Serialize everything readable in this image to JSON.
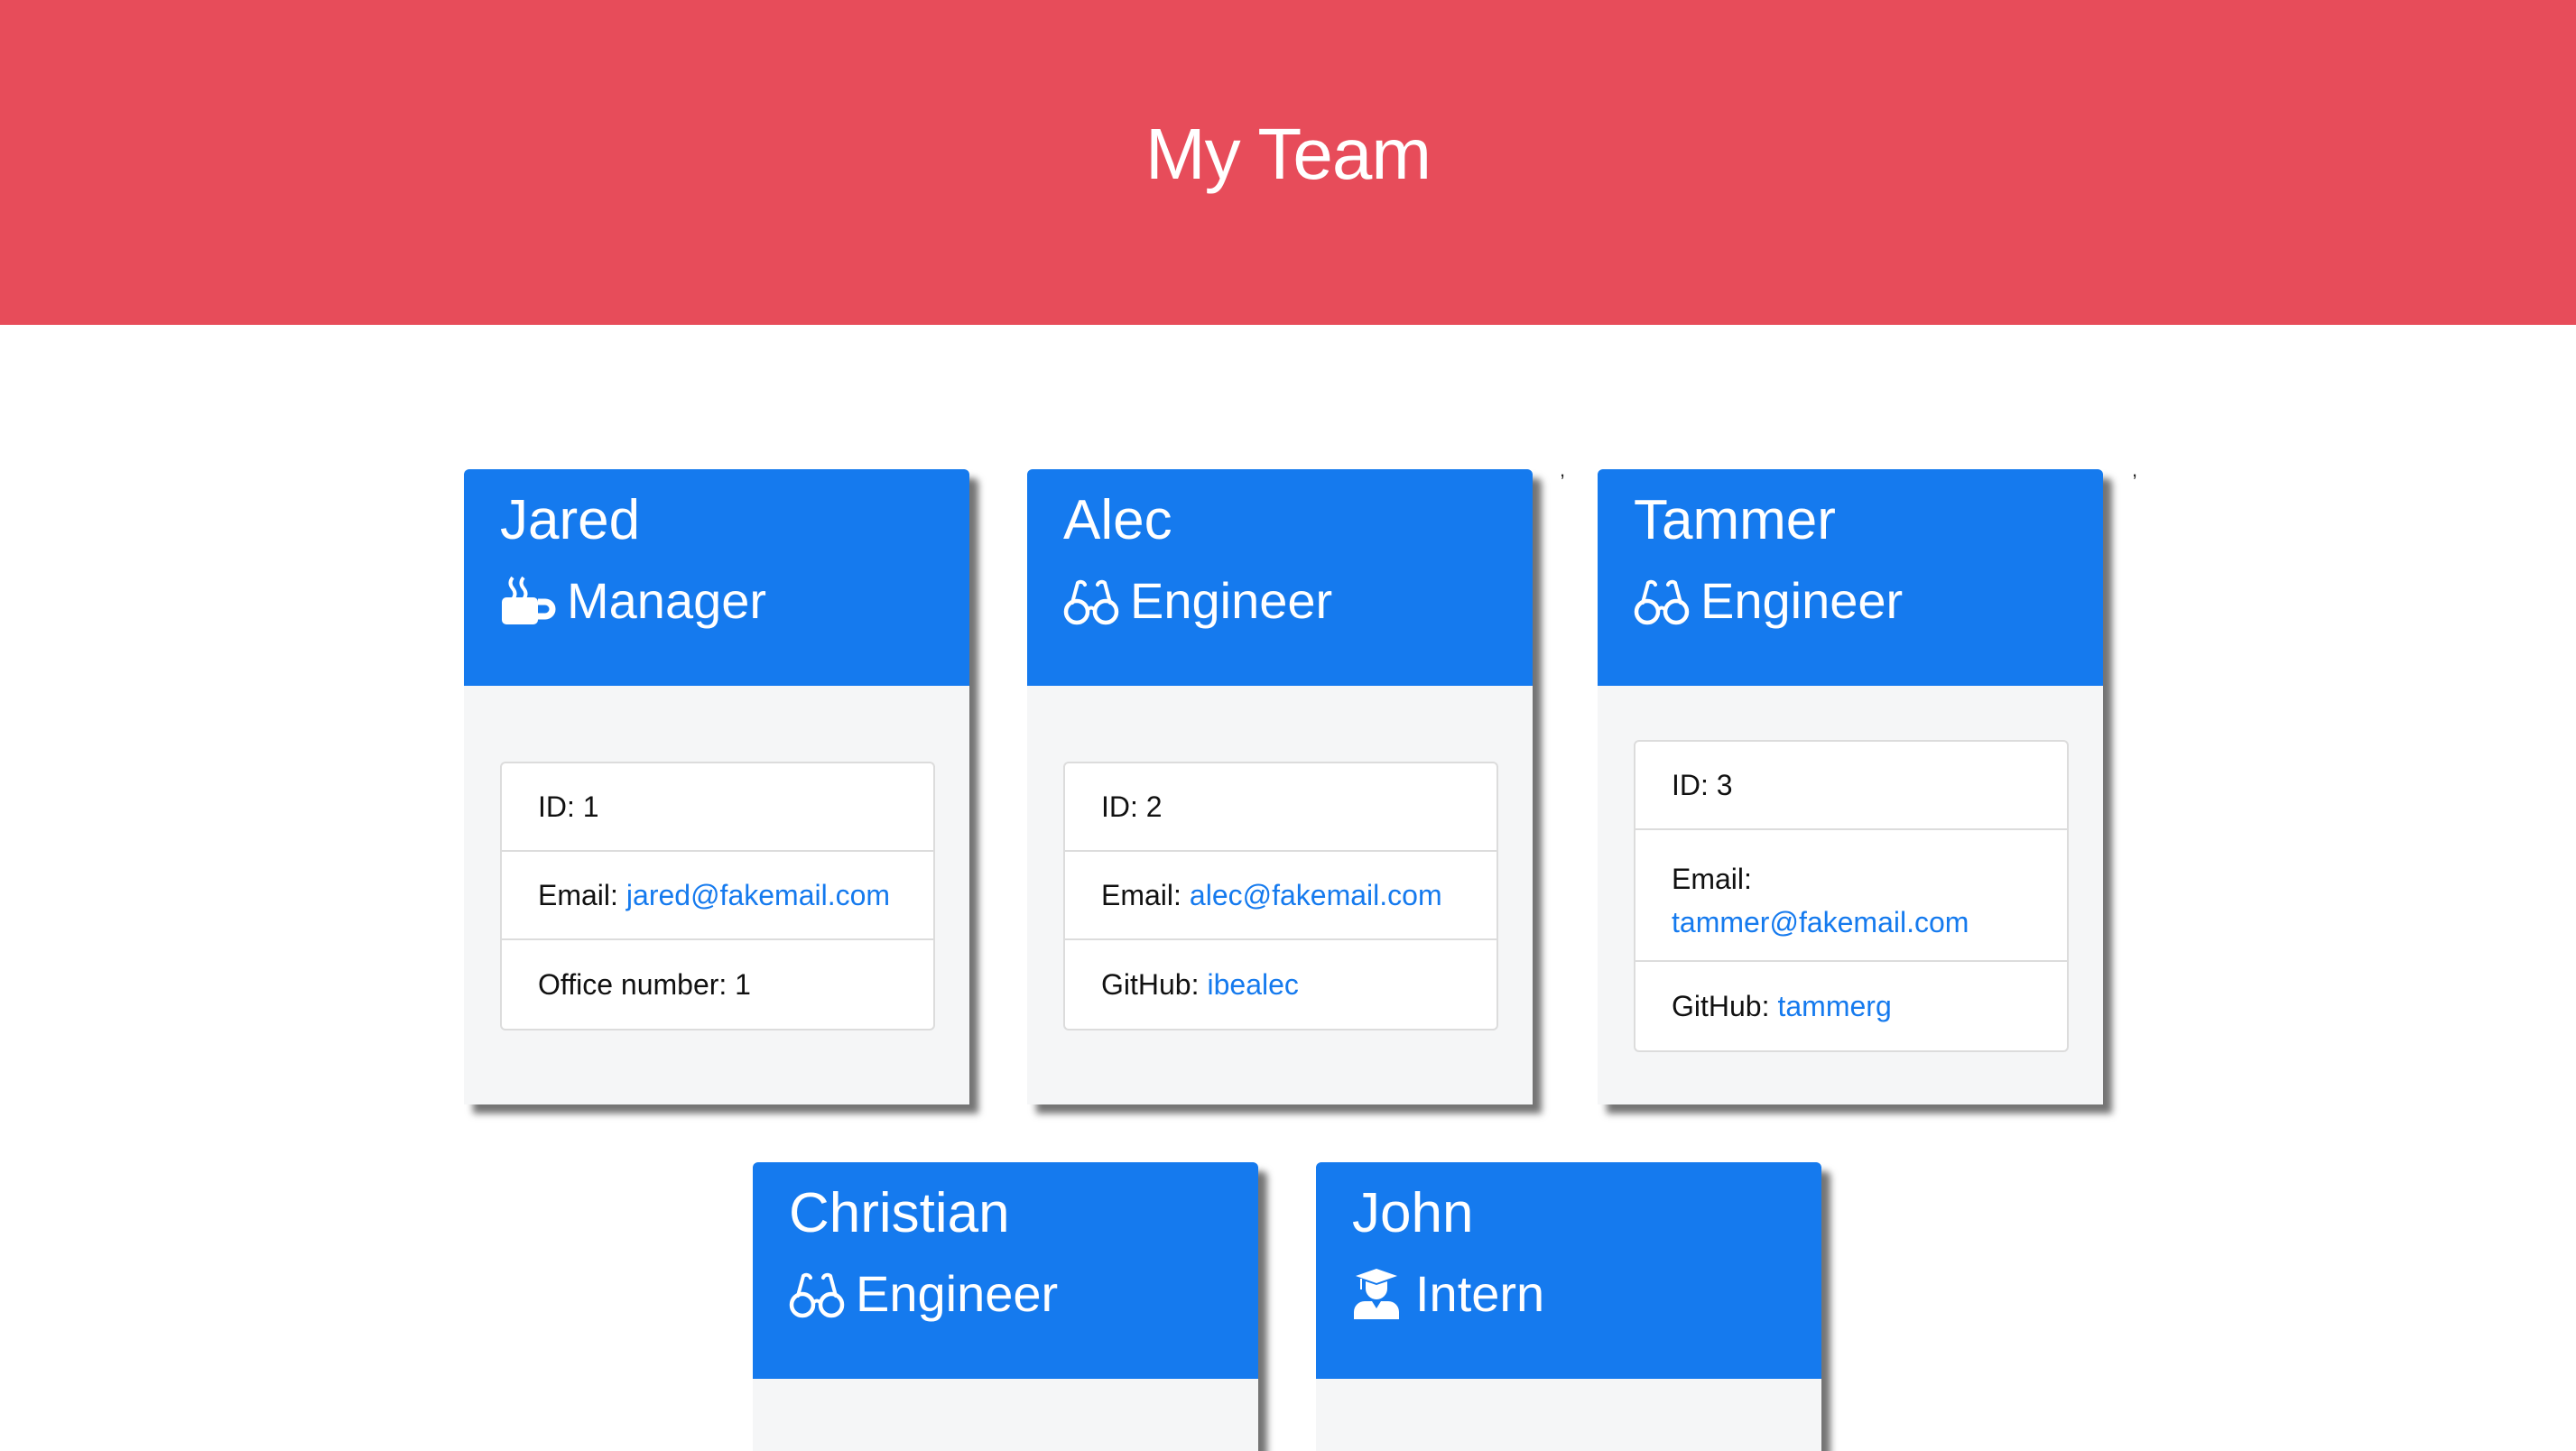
{
  "header": {
    "title": "My Team"
  },
  "colors": {
    "header_bg": "#e74c5a",
    "card_header_bg": "#157aee",
    "link": "#157aee"
  },
  "stray_marks": [
    ",",
    ","
  ],
  "employees": [
    {
      "name": "Jared",
      "role": "Manager",
      "role_icon": "coffee-mug-icon",
      "id_label": "ID: 1",
      "email_label": "Email:",
      "email": "jared@fakemail.com",
      "extra_label": "Office number: 1",
      "extra_link": ""
    },
    {
      "name": "Alec",
      "role": "Engineer",
      "role_icon": "glasses-icon",
      "id_label": "ID: 2",
      "email_label": "Email:",
      "email": "alec@fakemail.com",
      "extra_label": "GitHub:",
      "extra_link": "ibealec"
    },
    {
      "name": "Tammer",
      "role": "Engineer",
      "role_icon": "glasses-icon",
      "id_label": "ID: 3",
      "email_label": "Email:",
      "email": "tammer@fakemail.com",
      "extra_label": "GitHub:",
      "extra_link": "tammerg"
    },
    {
      "name": "Christian",
      "role": "Engineer",
      "role_icon": "glasses-icon"
    },
    {
      "name": "John",
      "role": "Intern",
      "role_icon": "graduate-icon"
    }
  ]
}
